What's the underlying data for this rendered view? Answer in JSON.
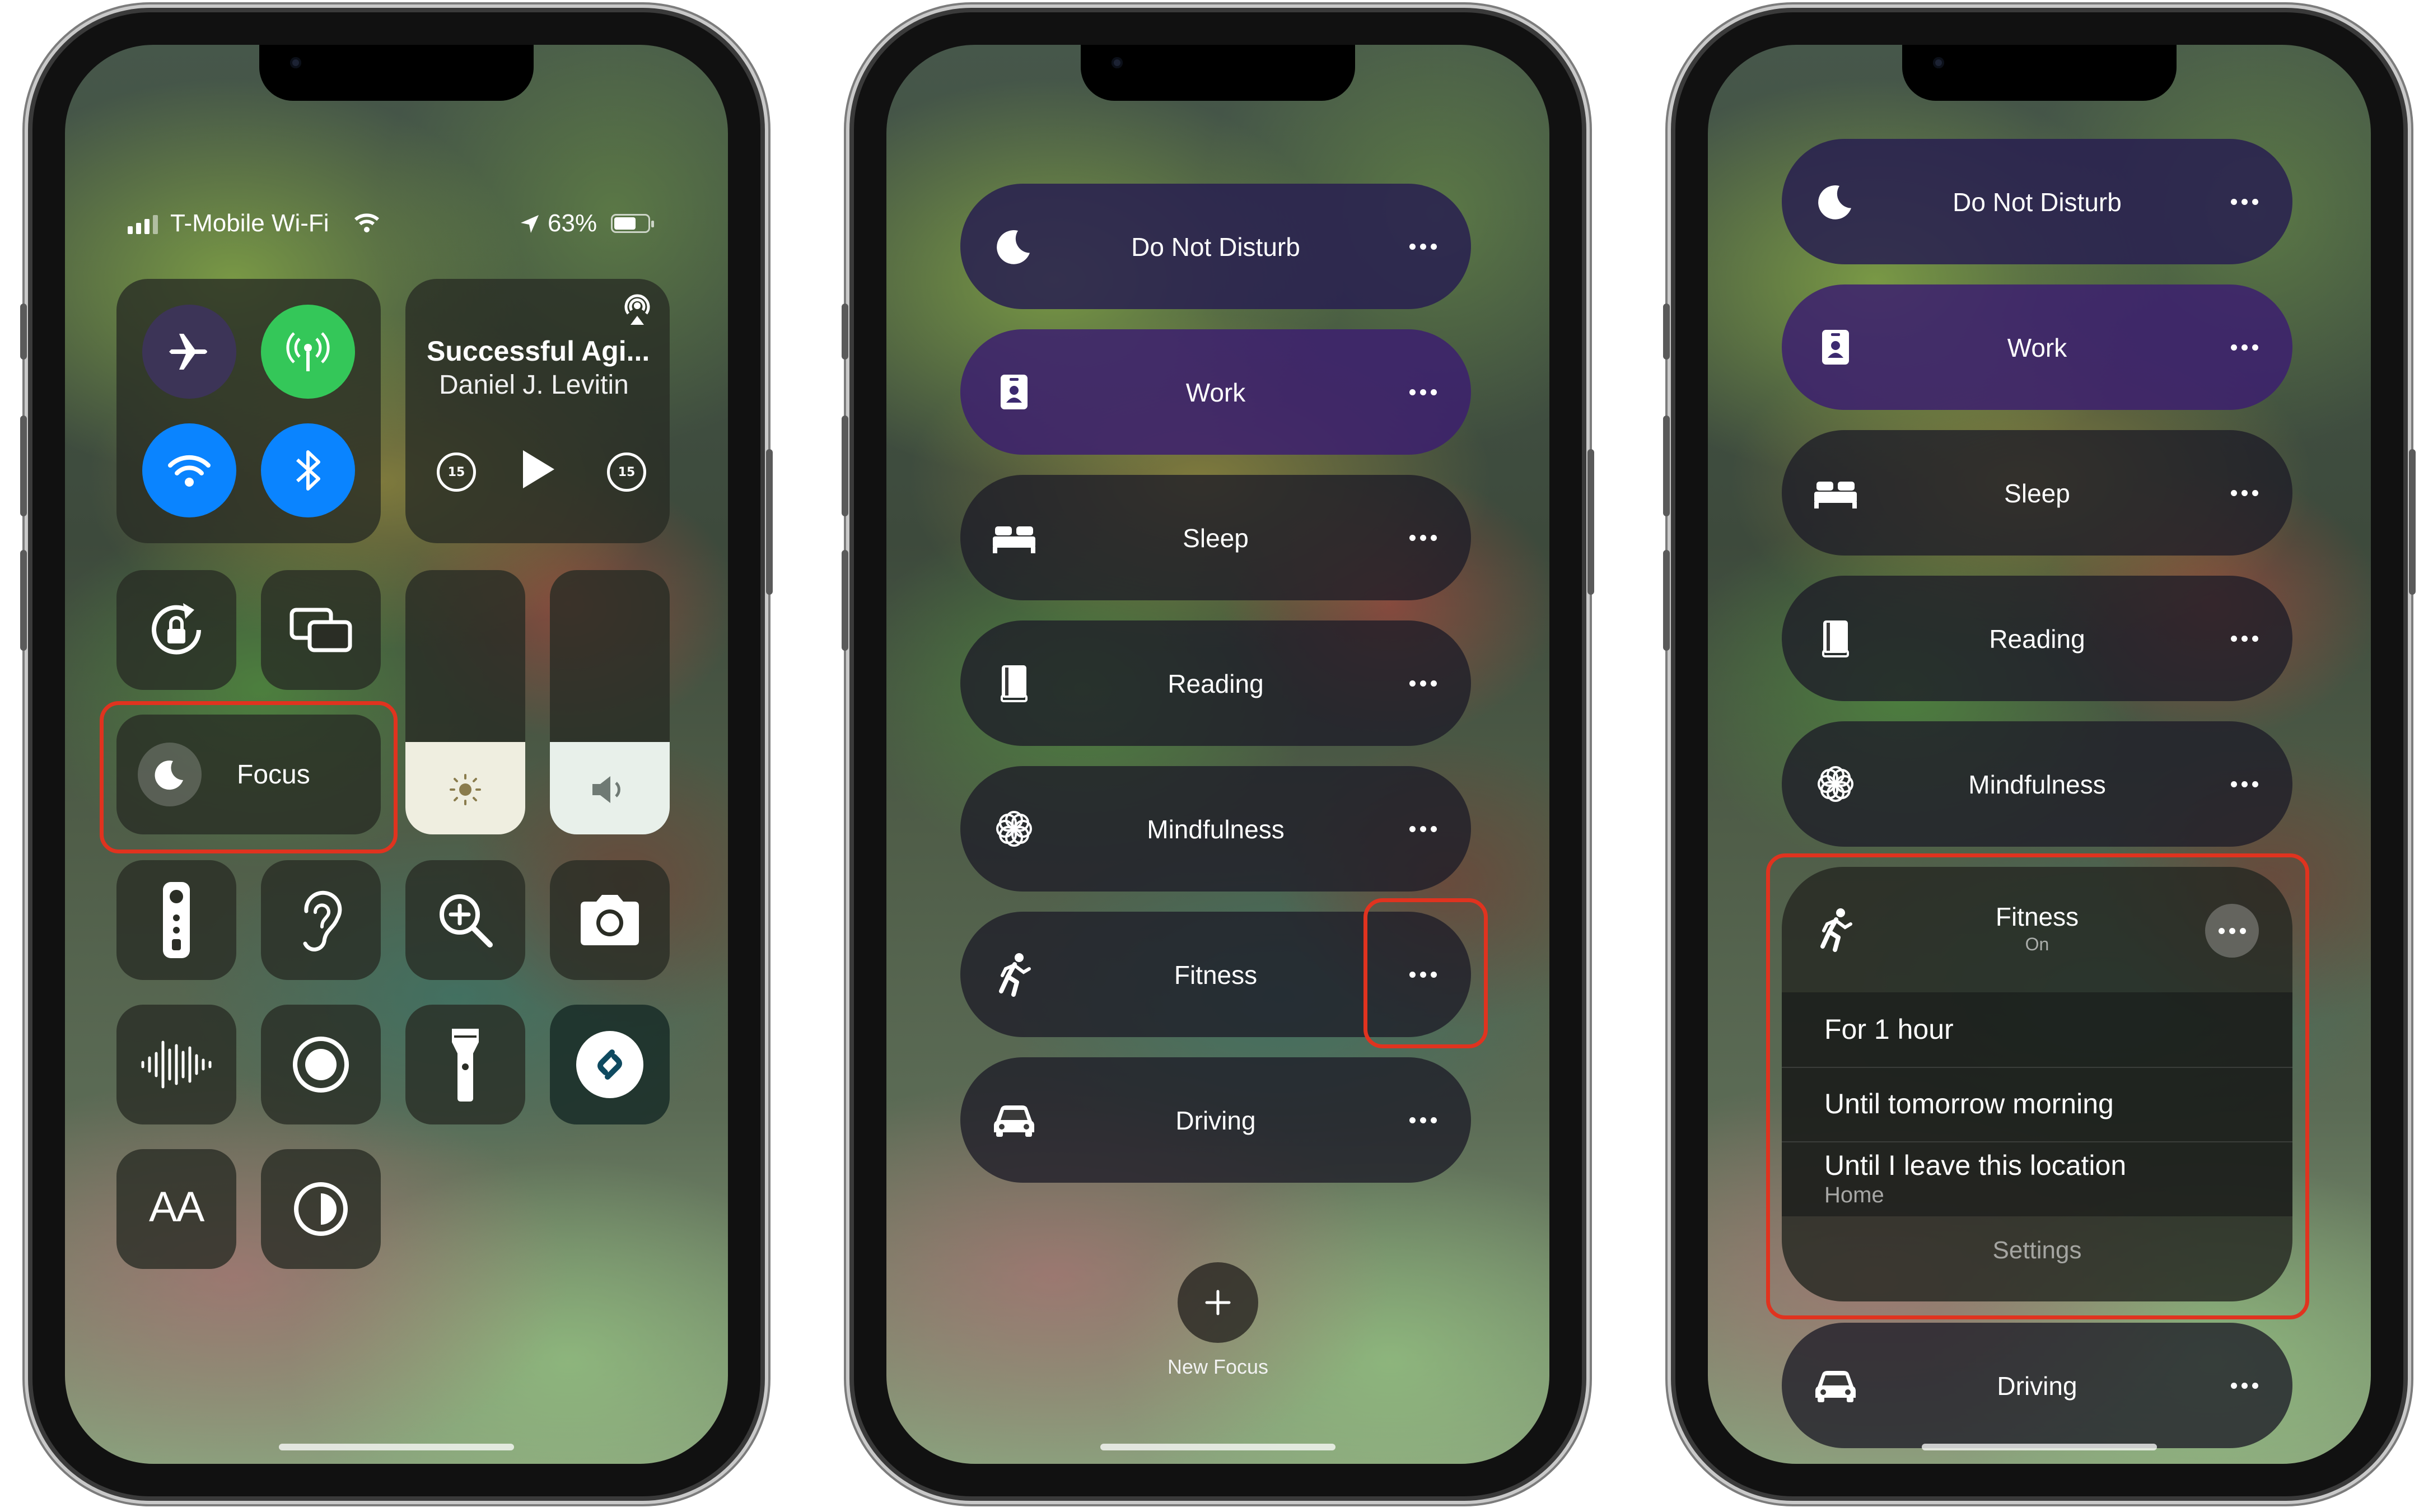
{
  "phone1": {
    "status": {
      "carrier": "T-Mobile Wi-Fi",
      "battery": "63%"
    },
    "connectivity": {
      "airplane": "airplane-icon",
      "cellular": "antenna-icon",
      "wifi": "wifi-icon",
      "bluetooth": "bluetooth-icon"
    },
    "now_playing": {
      "title": "Successful Agi...",
      "artist": "Daniel J. Levitin",
      "skip_back": "15",
      "skip_fwd": "15"
    },
    "focus_label": "Focus",
    "brightness_level": 0.35,
    "volume_level": 0.35,
    "tiles": [
      "orientation-lock-icon",
      "screen-mirroring-icon",
      "remote-icon",
      "hearing-icon",
      "magnifier-icon",
      "camera-icon",
      "sound-recognition-icon",
      "screen-record-icon",
      "flashlight-icon",
      "shazam-icon",
      "text-size-icon",
      "dark-mode-icon"
    ],
    "text_size_label": "AA"
  },
  "phone2": {
    "focus_modes": [
      {
        "label": "Do Not Disturb",
        "icon": "moon-icon"
      },
      {
        "label": "Work",
        "icon": "badge-icon"
      },
      {
        "label": "Sleep",
        "icon": "bed-icon"
      },
      {
        "label": "Reading",
        "icon": "book-icon"
      },
      {
        "label": "Mindfulness",
        "icon": "flower-icon"
      },
      {
        "label": "Fitness",
        "icon": "runner-icon"
      },
      {
        "label": "Driving",
        "icon": "car-icon"
      }
    ],
    "new_focus_label": "New Focus"
  },
  "phone3": {
    "focus_modes_top": [
      {
        "label": "Do Not Disturb"
      },
      {
        "label": "Work"
      },
      {
        "label": "Sleep"
      },
      {
        "label": "Reading"
      },
      {
        "label": "Mindfulness"
      }
    ],
    "fitness": {
      "label": "Fitness",
      "status": "On",
      "options": [
        "For 1 hour",
        "Until tomorrow morning",
        "Until I leave this location"
      ],
      "location_sub": "Home",
      "settings": "Settings"
    },
    "driving_label": "Driving"
  },
  "colors": {
    "highlight": "#e0331f",
    "airplane_bg": "#3c3457",
    "cellular_bg": "#34c759",
    "blue": "#0a84ff"
  }
}
